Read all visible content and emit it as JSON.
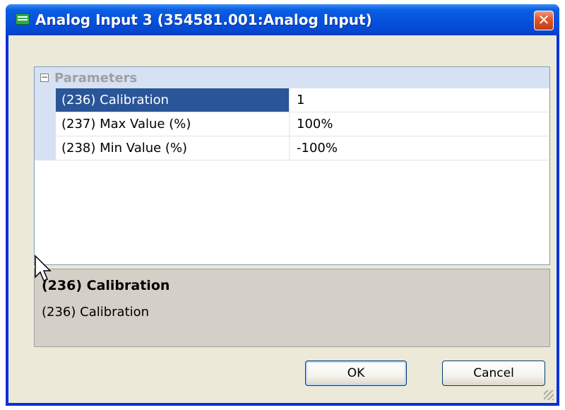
{
  "window": {
    "title": "Analog Input 3 (354581.001:Analog Input)",
    "close_symbol": "✕"
  },
  "grid": {
    "category_label": "Parameters",
    "collapse_symbol": "−",
    "rows": [
      {
        "name": "(236) Calibration",
        "value": "1",
        "selected": true
      },
      {
        "name": "(237) Max Value (%)",
        "value": "100%",
        "selected": false
      },
      {
        "name": "(238) Min Value (%)",
        "value": "-100%",
        "selected": false
      }
    ]
  },
  "description": {
    "title": "(236) Calibration",
    "body": "(236) Calibration"
  },
  "buttons": {
    "ok_label": "OK",
    "cancel_label": "Cancel"
  },
  "colors": {
    "title_bar": "#0653dc",
    "selection": "#2a5598",
    "dialog_bg": "#ece9d8"
  }
}
